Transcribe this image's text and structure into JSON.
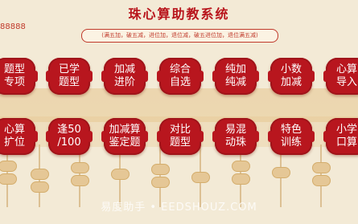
{
  "app": {
    "title": "珠心算助教系统",
    "phone": "88888",
    "formula_tags": "(满五加，破五减，进位加，退位减，破五进位加，退位满五减)"
  },
  "buttons_row1": [
    {
      "label": "题型\n专项"
    },
    {
      "label": "已学\n题型"
    },
    {
      "label": "加减\n进阶"
    },
    {
      "label": "综合\n自选"
    },
    {
      "label": "纯加\n纯减"
    },
    {
      "label": "小数\n加减"
    },
    {
      "label": "心算\n导入"
    }
  ],
  "buttons_row2": [
    {
      "label": "心算\n扩位"
    },
    {
      "label": "逢50\n/100"
    },
    {
      "label": "加减算\n鉴定题"
    },
    {
      "label": "对比\n题型"
    },
    {
      "label": "易混\n动珠"
    },
    {
      "label": "特色\n训练"
    },
    {
      "label": "小学\n口算"
    }
  ],
  "watermark": "易度助手 • EEDSHOUZ.COM",
  "colors": {
    "accent": "#b8161e",
    "background": "#f3ead6",
    "bead": "#e5c796"
  }
}
